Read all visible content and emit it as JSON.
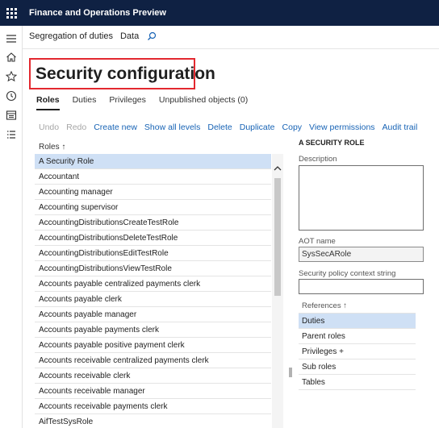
{
  "app": {
    "title": "Finance and Operations Preview"
  },
  "breadcrumbs": {
    "items": [
      "Segregation of duties",
      "Data"
    ]
  },
  "page": {
    "title": "Security configuration"
  },
  "tabs": [
    {
      "label": "Roles",
      "active": true
    },
    {
      "label": "Duties",
      "active": false
    },
    {
      "label": "Privileges",
      "active": false
    },
    {
      "label": "Unpublished objects (0)",
      "active": false
    }
  ],
  "toolbar": {
    "undo": "Undo",
    "redo": "Redo",
    "create_new": "Create new",
    "show_all_levels": "Show all levels",
    "delete": "Delete",
    "duplicate": "Duplicate",
    "copy": "Copy",
    "view_permissions": "View permissions",
    "audit_trail": "Audit trail"
  },
  "roles_grid": {
    "header": "Roles ↑",
    "rows": [
      "A Security Role",
      "Accountant",
      "Accounting manager",
      "Accounting supervisor",
      "AccountingDistributionsCreateTestRole",
      "AccountingDistributionsDeleteTestRole",
      "AccountingDistributionsEditTestRole",
      "AccountingDistributionsViewTestRole",
      "Accounts payable centralized payments clerk",
      "Accounts payable clerk",
      "Accounts payable manager",
      "Accounts payable payments clerk",
      "Accounts payable positive payment clerk",
      "Accounts receivable centralized payments clerk",
      "Accounts receivable clerk",
      "Accounts receivable manager",
      "Accounts receivable payments clerk",
      "AifTestSysRole"
    ],
    "selected_index": 0
  },
  "detail": {
    "title": "A SECURITY ROLE",
    "description_label": "Description",
    "description_value": "",
    "aot_label": "AOT name",
    "aot_value": "SysSecARole",
    "policy_label": "Security policy context string",
    "policy_value": ""
  },
  "references": {
    "header": "References ↑",
    "items": [
      "Duties",
      "Parent roles",
      "Privileges +",
      "Sub roles",
      "Tables"
    ],
    "selected_index": 0
  },
  "colors": {
    "topbar": "#0f2143",
    "link": "#1763b5",
    "selection": "#cfe0f5",
    "highlight_border": "#e3282f"
  }
}
